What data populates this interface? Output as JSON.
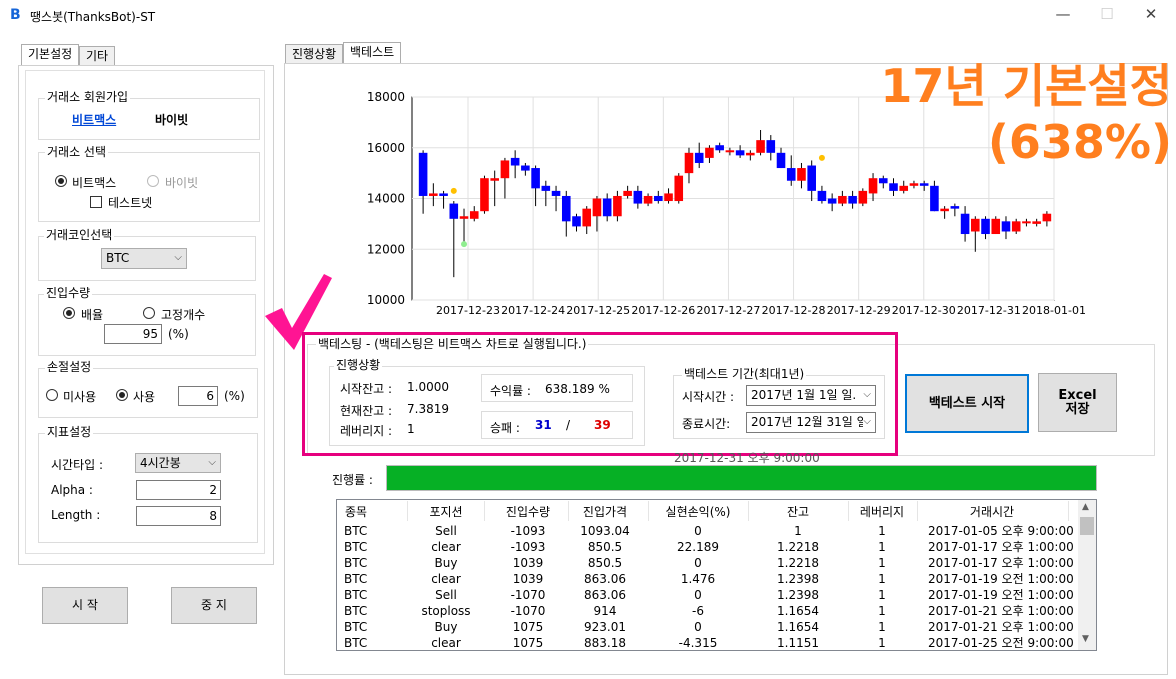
{
  "window": {
    "title": "땡스봇(ThanksBot)-ST",
    "icon": "B",
    "min": "—",
    "max": "☐",
    "close": "✕"
  },
  "left": {
    "tabs": [
      "기본설정",
      "기타"
    ],
    "exchange_signup": {
      "title": "거래소 회원가입",
      "links": [
        "비트맥스",
        "바이빗"
      ]
    },
    "exchange_select": {
      "title": "거래소 선택",
      "options": [
        "비트맥스",
        "바이빗"
      ],
      "testnet": "테스트넷"
    },
    "coin_select": {
      "title": "거래코인선택",
      "value": "BTC"
    },
    "entry_qty": {
      "title": "진입수량",
      "options": [
        "배율",
        "고정개수"
      ],
      "value": "95",
      "unit": "(%)"
    },
    "stoploss": {
      "title": "손절설정",
      "options": [
        "미사용",
        "사용"
      ],
      "value": "6",
      "unit": "(%)"
    },
    "indicator": {
      "title": "지표설정",
      "timetype_label": "시간타입 :",
      "timetype": "4시간봉",
      "alpha_label": "Alpha :",
      "alpha": "2",
      "length_label": "Length :",
      "length": "8"
    },
    "start": "시 작",
    "stop": "중 지"
  },
  "right": {
    "tabs": [
      "진행상황",
      "백테스트"
    ],
    "overlay": {
      "line1": "17년 기본설정",
      "line2": "(638%)"
    },
    "bt_group_title": "백테스팅 - (백테스팅은 비트맥스 차트로 실행됩니다.)",
    "progress_group_title": "진행상황",
    "start_balance_label": "시작잔고 :",
    "start_balance": "1.0000",
    "current_balance_label": "현재잔고 :",
    "current_balance": "7.3819",
    "leverage_label": "레버리지 :",
    "leverage": "1",
    "return_label": "수익률 :",
    "return_value": "638.189 %",
    "winloss_label": "승패 :",
    "wins": "31",
    "slash": "/",
    "losses": "39",
    "period_title": "백테스트 기간(최대1년)",
    "start_time_label": "시작시간 :",
    "start_time": "2017년  1월  1일 일.",
    "end_time_label": "종료시간:",
    "end_time": "2017년 12월 31일 일.",
    "run_button": "백테스트 시작",
    "excel_button_1": "Excel",
    "excel_button_2": "저장",
    "current_time": "2017-12-31 오후 9:00:00",
    "progress_label": "진행률 :",
    "progress": 1.0,
    "table": {
      "headers": [
        "종목",
        "포지션",
        "진입수량",
        "진입가격",
        "실현손익(%)",
        "잔고",
        "레버리지",
        "거래시간"
      ],
      "rows": [
        [
          "BTC",
          "Sell",
          "-1093",
          "1093.04",
          "0",
          "1",
          "1",
          "2017-01-05 오후 9:00:00"
        ],
        [
          "BTC",
          "clear",
          "-1093",
          "850.5",
          "22.189",
          "1.2218",
          "1",
          "2017-01-17 오후 1:00:00"
        ],
        [
          "BTC",
          "Buy",
          "1039",
          "850.5",
          "0",
          "1.2218",
          "1",
          "2017-01-17 오후 1:00:00"
        ],
        [
          "BTC",
          "clear",
          "1039",
          "863.06",
          "1.476",
          "1.2398",
          "1",
          "2017-01-19 오전 1:00:00"
        ],
        [
          "BTC",
          "Sell",
          "-1070",
          "863.06",
          "0",
          "1.2398",
          "1",
          "2017-01-19 오전 1:00:00"
        ],
        [
          "BTC",
          "stoploss",
          "-1070",
          "914",
          "-6",
          "1.1654",
          "1",
          "2017-01-21 오후 1:00:00"
        ],
        [
          "BTC",
          "Buy",
          "1075",
          "923.01",
          "0",
          "1.1654",
          "1",
          "2017-01-21 오후 1:00:00"
        ],
        [
          "BTC",
          "clear",
          "1075",
          "883.18",
          "-4.315",
          "1.1151",
          "1",
          "2017-01-25 오전 9:00:00"
        ]
      ]
    }
  },
  "chart_data": {
    "type": "candlestick",
    "ylim": [
      10000,
      18000
    ],
    "yticks": [
      "18000",
      "16000",
      "14000",
      "12000",
      "10000"
    ],
    "xticks": [
      "2017-12-23",
      "2017-12-24",
      "2017-12-25",
      "2017-12-26",
      "2017-12-27",
      "2017-12-28",
      "2017-12-29",
      "2017-12-30",
      "2017-12-31",
      "2018-01-01"
    ],
    "colors": {
      "up": "#ff0000",
      "down": "#0000ff"
    },
    "candles": [
      [
        15800,
        14100,
        15900,
        13400
      ],
      [
        14100,
        14200,
        14600,
        13700
      ],
      [
        14200,
        14100,
        14300,
        13600
      ],
      [
        13800,
        13200,
        13900,
        10900
      ],
      [
        13200,
        13300,
        13600,
        12200
      ],
      [
        13200,
        13500,
        13700,
        13100
      ],
      [
        13500,
        14800,
        14900,
        13400
      ],
      [
        14700,
        14800,
        15100,
        13700
      ],
      [
        14800,
        15500,
        15600,
        14000
      ],
      [
        15600,
        15300,
        15900,
        14800
      ],
      [
        15300,
        15100,
        15400,
        14900
      ],
      [
        15200,
        14400,
        15300,
        13700
      ],
      [
        14500,
        14300,
        14700,
        13700
      ],
      [
        14300,
        14100,
        14500,
        13500
      ],
      [
        14100,
        13100,
        14300,
        12500
      ],
      [
        13300,
        12900,
        13400,
        12700
      ],
      [
        12900,
        13600,
        13700,
        12600
      ],
      [
        13300,
        14000,
        14100,
        12700
      ],
      [
        14000,
        13300,
        14200,
        13100
      ],
      [
        13300,
        14100,
        14300,
        13100
      ],
      [
        14100,
        14300,
        14500,
        14000
      ],
      [
        14300,
        13800,
        14500,
        13600
      ],
      [
        13800,
        14100,
        14200,
        13700
      ],
      [
        14100,
        13900,
        14300,
        13800
      ],
      [
        13900,
        14200,
        14400,
        13800
      ],
      [
        13900,
        14900,
        15000,
        13800
      ],
      [
        15000,
        15800,
        16000,
        14600
      ],
      [
        15800,
        15400,
        16200,
        15200
      ],
      [
        15600,
        16000,
        16100,
        15400
      ],
      [
        16100,
        15900,
        16200,
        15800
      ],
      [
        15900,
        15900,
        16000,
        15700
      ],
      [
        15900,
        15700,
        16100,
        15600
      ],
      [
        15700,
        15800,
        15900,
        15500
      ],
      [
        15800,
        16300,
        16700,
        15700
      ],
      [
        16300,
        15800,
        16500,
        15500
      ],
      [
        15800,
        15200,
        16000,
        15200
      ],
      [
        15200,
        14700,
        15700,
        14500
      ],
      [
        14700,
        15200,
        15400,
        14400
      ],
      [
        15300,
        14300,
        15500,
        13900
      ],
      [
        14300,
        13900,
        14500,
        13800
      ],
      [
        14000,
        13800,
        14200,
        13500
      ],
      [
        13800,
        14100,
        14300,
        13700
      ],
      [
        14100,
        13800,
        14300,
        13600
      ],
      [
        13800,
        14300,
        14400,
        13700
      ],
      [
        14200,
        14800,
        15000,
        13900
      ],
      [
        14800,
        14600,
        14900,
        14400
      ],
      [
        14600,
        14300,
        14800,
        14100
      ],
      [
        14300,
        14500,
        14700,
        14200
      ],
      [
        14500,
        14600,
        14700,
        14400
      ],
      [
        14600,
        14500,
        14700,
        14300
      ],
      [
        14500,
        13500,
        14700,
        13500
      ],
      [
        13500,
        13600,
        13700,
        13200
      ],
      [
        13700,
        13600,
        13800,
        13300
      ],
      [
        13400,
        12600,
        13700,
        12300
      ],
      [
        12700,
        13200,
        13300,
        11900
      ],
      [
        13200,
        12600,
        13300,
        12400
      ],
      [
        12600,
        13200,
        13300,
        12600
      ],
      [
        13100,
        12700,
        13300,
        12400
      ],
      [
        12700,
        13100,
        13200,
        12600
      ],
      [
        13100,
        13100,
        13200,
        12900
      ],
      [
        13000,
        13100,
        13200,
        12900
      ],
      [
        13100,
        13400,
        13500,
        12900
      ]
    ],
    "markers": [
      {
        "i": 3,
        "price": 14300,
        "color": "#ffc000"
      },
      {
        "i": 4,
        "price": 12200,
        "color": "#90ee90"
      },
      {
        "i": 39,
        "price": 15600,
        "color": "#ffc000"
      }
    ]
  }
}
